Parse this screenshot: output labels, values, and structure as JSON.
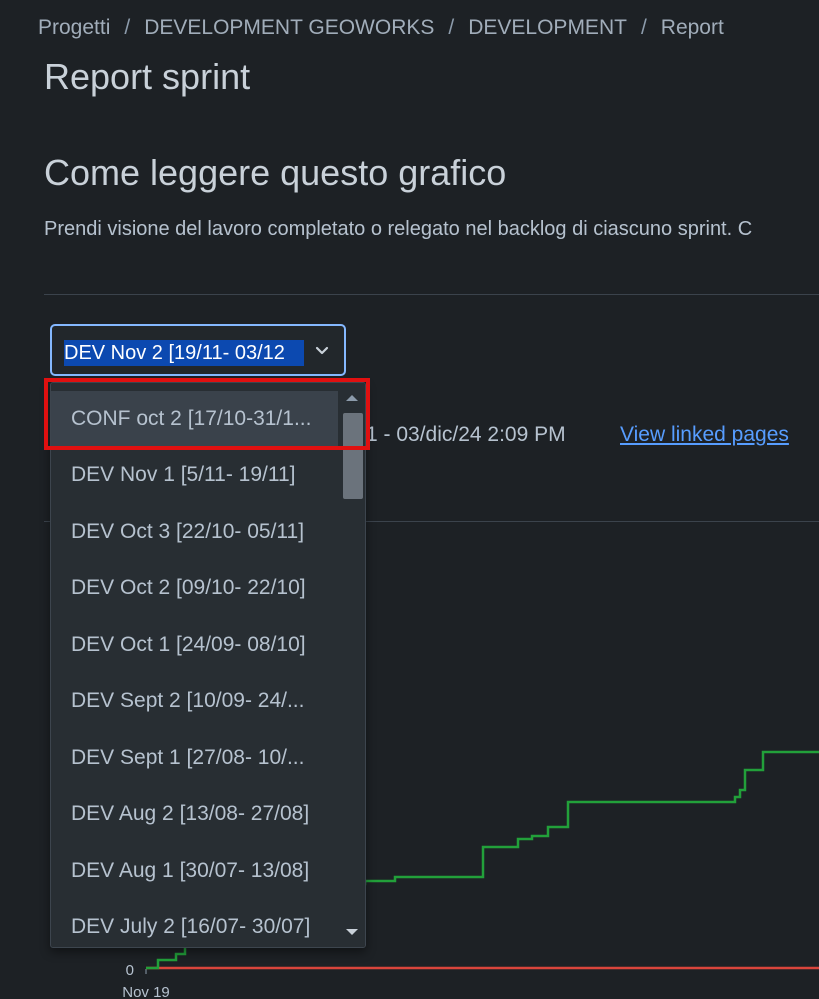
{
  "breadcrumb": {
    "items": [
      "Progetti",
      "DEVELOPMENT GEOWORKS",
      "DEVELOPMENT",
      "Report"
    ],
    "separator": "/"
  },
  "page": {
    "title": "Report sprint",
    "section_title": "Come leggere questo grafico",
    "description": "Prendi visione del lavoro completato o relegato nel backlog di ciascuno sprint. C"
  },
  "sprint_select": {
    "selected": "DEV Nov 2 [19/11- 03/12",
    "options": [
      "CONF oct 2 [17/10-31/1...",
      "DEV Nov 1 [5/11- 19/11]",
      "DEV Oct 3 [22/10- 05/11]",
      "DEV Oct 2 [09/10- 22/10]",
      "DEV Oct 1 [24/09- 08/10]",
      "DEV Sept 2 [10/09- 24/...",
      "DEV Sept 1 [27/08- 10/...",
      "DEV Aug 2 [13/08- 27/08]",
      "DEV Aug 1 [30/07- 13/08]",
      "DEV July 2 [16/07- 30/07]"
    ],
    "highlighted_index": 0
  },
  "sprint_info": {
    "date_range": "1 - 03/dic/24 2:09 PM",
    "linked_pages_label": "View linked pages"
  },
  "chart": {
    "y_tick_zero": "0",
    "x_tick_start": "Nov 19",
    "colors": {
      "completed": "#22a03a",
      "baseline": "#d9453c"
    }
  },
  "colors": {
    "background": "#1d2125",
    "accent": "#579dff",
    "highlight_box": "#e01010"
  }
}
